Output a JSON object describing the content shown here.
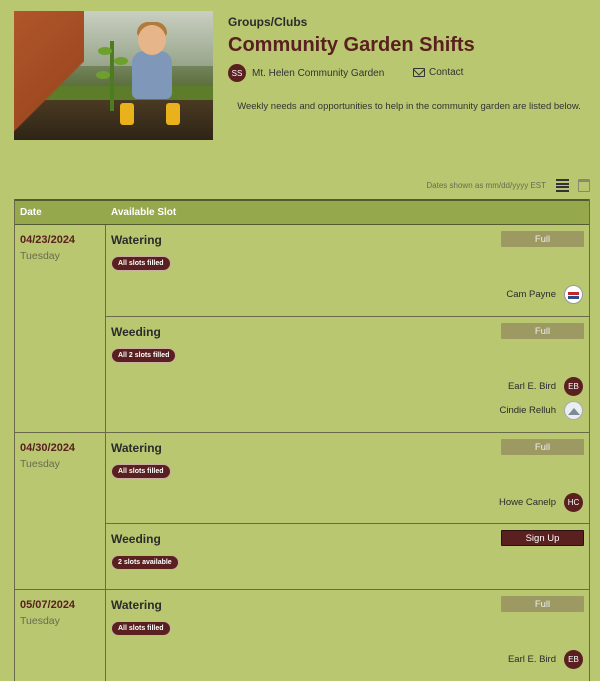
{
  "header": {
    "category": "Groups/Clubs",
    "title": "Community Garden Shifts",
    "organizer_initials": "SS",
    "organizer_name": "Mt. Helen Community Garden",
    "contact_label": "Contact",
    "description": "Weekly needs and opportunities to help in the community garden are listed below."
  },
  "view": {
    "dates_note": "Dates shown as mm/dd/yyyy EST",
    "list_icon": "list-view-icon",
    "calendar_icon": "calendar-view-icon"
  },
  "table": {
    "col_date": "Date",
    "col_slot": "Available Slot",
    "groups": [
      {
        "date": "04/23/2024",
        "weekday": "Tuesday",
        "slots": [
          {
            "name": "Watering",
            "status": "All slots filled",
            "button": "Full",
            "people": [
              {
                "name": "Cam Payne",
                "avatar": "vote-badge"
              }
            ]
          },
          {
            "name": "Weeding",
            "status": "All 2 slots filled",
            "button": "Full",
            "people": [
              {
                "name": "Earl E. Bird",
                "initials": "EB"
              },
              {
                "name": "Cindie Relluh",
                "avatar": "mountain-image"
              }
            ]
          }
        ]
      },
      {
        "date": "04/30/2024",
        "weekday": "Tuesday",
        "slots": [
          {
            "name": "Watering",
            "status": "All slots filled",
            "button": "Full",
            "people": [
              {
                "name": "Howe Canelp",
                "initials": "HC"
              }
            ]
          },
          {
            "name": "Weeding",
            "status": "2 slots available",
            "button": "Sign Up",
            "people": []
          }
        ]
      },
      {
        "date": "05/07/2024",
        "weekday": "Tuesday",
        "slots": [
          {
            "name": "Watering",
            "status": "All slots filled",
            "button": "Full",
            "people": [
              {
                "name": "Earl E. Bird",
                "initials": "EB"
              }
            ]
          }
        ]
      }
    ]
  },
  "colors": {
    "background": "#b8c770",
    "header_bar": "#96a84c",
    "accent": "#5a2020",
    "full_button": "#9c9a62"
  }
}
